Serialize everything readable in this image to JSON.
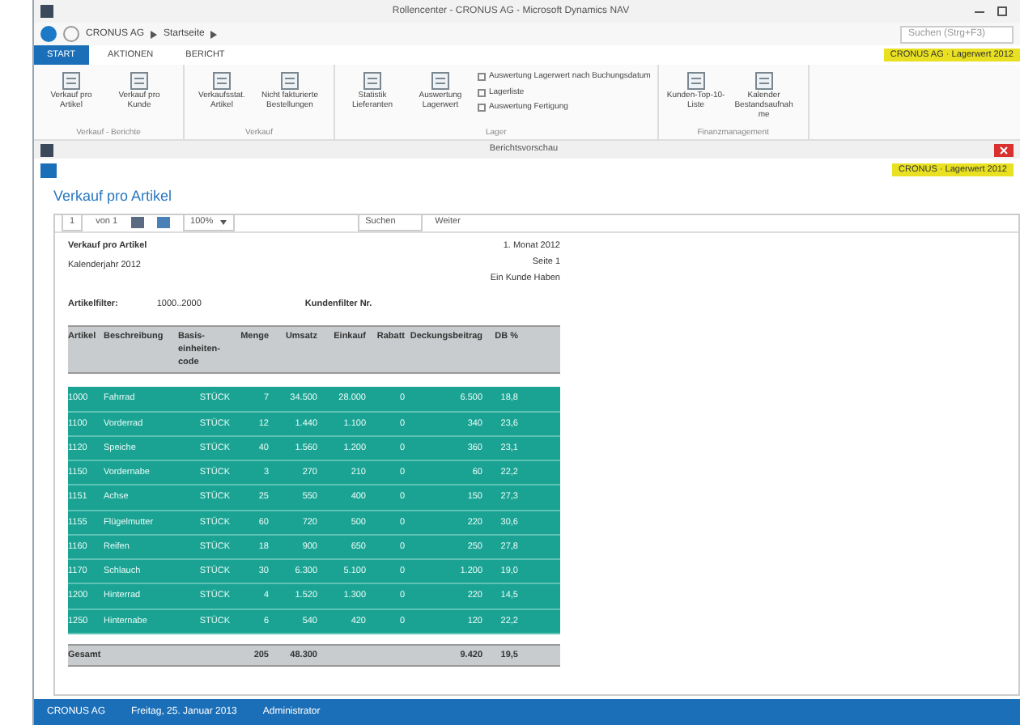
{
  "window": {
    "title": "Rollencenter - CRONUS AG - Microsoft Dynamics NAV"
  },
  "address": {
    "path": [
      "CRONUS AG",
      "Startseite"
    ],
    "search": "Suchen (Strg+F3)"
  },
  "ribbon_tabs": [
    {
      "label": "START",
      "selected": true
    },
    {
      "label": "AKTIONEN",
      "selected": false
    },
    {
      "label": "BERICHT",
      "selected": false
    }
  ],
  "company_badge": "CRONUS AG · Lagerwert 2012",
  "ribbon_groups": [
    {
      "label": "Verkauf - Berichte",
      "items": [
        {
          "kind": "button",
          "label": "Verkauf pro Artikel"
        },
        {
          "kind": "button",
          "label": "Verkauf pro Kunde"
        }
      ]
    },
    {
      "label": "Verkauf",
      "items": [
        {
          "kind": "button",
          "label": "Verkaufsstat. Artikel"
        },
        {
          "kind": "button",
          "label": "Nicht fakturierte Bestellungen"
        }
      ]
    },
    {
      "label": "Lager",
      "items": [
        {
          "kind": "button",
          "label": "Statistik Lieferanten"
        },
        {
          "kind": "button",
          "label": "Auswertung Lagerwert"
        },
        {
          "kind": "check",
          "label": "Auswertung Lagerwert nach Buchungsdatum",
          "checked": false
        },
        {
          "kind": "check",
          "label": "Lagerliste",
          "checked": false
        },
        {
          "kind": "check",
          "label": "Auswertung Fertigung",
          "checked": false
        }
      ]
    },
    {
      "label": "Finanzmanagement",
      "items": [
        {
          "kind": "button",
          "label": "Kunden-Top-10-Liste"
        },
        {
          "kind": "button",
          "label": "Kalender Bestandsaufnahme"
        }
      ]
    }
  ],
  "inner_window": {
    "title": "Berichtsvorschau",
    "badge": "CRONUS · Lagerwert 2012"
  },
  "page_title": "Verkauf pro Artikel",
  "viewer_toolbar": {
    "page": "1",
    "of": "von 1",
    "zoom": "100%",
    "find": "Suchen",
    "next": "Weiter"
  },
  "report": {
    "title": "Verkauf pro Artikel",
    "subtitle": "Kalenderjahr 2012",
    "meta": [
      "1. Monat 2012",
      "Seite 1",
      "Ein Kunde Haben"
    ],
    "filter_label": "Artikelfilter:",
    "filter_value": "1000..2000",
    "filter2_label": "Kundenfilter Nr.",
    "columns": [
      "Artikel",
      "Beschreibung",
      "Basis-einheiten-code",
      "Menge",
      "Umsatz",
      "Einkauf",
      "Rabatt",
      "Deckungsbeitrag",
      "DB %"
    ],
    "rows": [
      [
        "1000",
        "Fahrrad",
        "STÜCK",
        "7",
        "34.500",
        "28.000",
        "0",
        "6.500",
        "18,8"
      ],
      [
        "1100",
        "Vorderrad",
        "STÜCK",
        "12",
        "1.440",
        "1.100",
        "0",
        "340",
        "23,6"
      ],
      [
        "1120",
        "Speiche",
        "STÜCK",
        "40",
        "1.560",
        "1.200",
        "0",
        "360",
        "23,1"
      ],
      [
        "1150",
        "Vordernabe",
        "STÜCK",
        "3",
        "270",
        "210",
        "0",
        "60",
        "22,2"
      ],
      [
        "1151",
        "Achse",
        "STÜCK",
        "25",
        "550",
        "400",
        "0",
        "150",
        "27,3"
      ],
      [
        "1155",
        "Flügelmutter",
        "STÜCK",
        "60",
        "720",
        "500",
        "0",
        "220",
        "30,6"
      ],
      [
        "1160",
        "Reifen",
        "STÜCK",
        "18",
        "900",
        "650",
        "0",
        "250",
        "27,8"
      ],
      [
        "1170",
        "Schlauch",
        "STÜCK",
        "30",
        "6.300",
        "5.100",
        "0",
        "1.200",
        "19,0"
      ],
      [
        "1200",
        "Hinterrad",
        "STÜCK",
        "4",
        "1.520",
        "1.300",
        "0",
        "220",
        "14,5"
      ],
      [
        "1250",
        "Hinternabe",
        "STÜCK",
        "6",
        "540",
        "420",
        "0",
        "120",
        "22,2"
      ]
    ],
    "total": {
      "label": "Gesamt",
      "qty": "205",
      "sales": "48.300",
      "profit": "9.420",
      "pct": "19,5"
    }
  },
  "status_bar": [
    "CRONUS AG",
    "Freitag, 25. Januar 2013",
    "Administrator"
  ]
}
